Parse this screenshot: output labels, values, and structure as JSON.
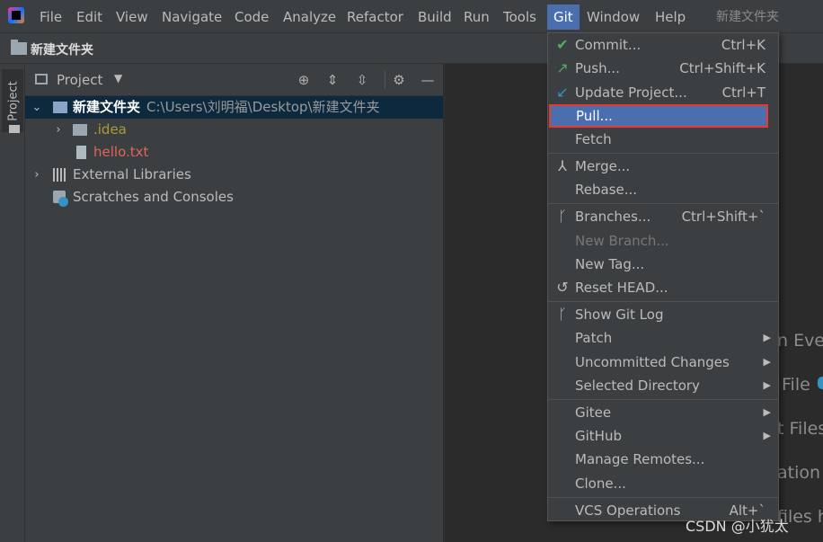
{
  "menubar": {
    "items": [
      "File",
      "Edit",
      "View",
      "Navigate",
      "Code",
      "Analyze",
      "Refactor",
      "Build",
      "Run",
      "Tools",
      "Git",
      "Window",
      "Help"
    ],
    "window_title": "新建文件夹"
  },
  "navbar": {
    "folder": "新建文件夹"
  },
  "stripe": {
    "project_tab": "Project"
  },
  "project_panel": {
    "title": "Project",
    "tree": [
      {
        "label": "新建文件夹",
        "path": "C:\\Users\\刘明福\\Desktop\\新建文件夹"
      },
      {
        "label": ".idea"
      },
      {
        "label": "hello.txt"
      },
      {
        "label": "External Libraries"
      },
      {
        "label": "Scratches and Consoles"
      }
    ]
  },
  "editor": {
    "hints": [
      "n Ever",
      "File",
      "t Files",
      "ation",
      "files h"
    ]
  },
  "git_menu": {
    "items": [
      {
        "label": "Commit...",
        "shortcut": "Ctrl+K"
      },
      {
        "label": "Push...",
        "shortcut": "Ctrl+Shift+K"
      },
      {
        "label": "Update Project...",
        "shortcut": "Ctrl+T"
      },
      {
        "label": "Pull..."
      },
      {
        "label": "Fetch"
      },
      {
        "label": "Merge..."
      },
      {
        "label": "Rebase..."
      },
      {
        "label": "Branches...",
        "shortcut": "Ctrl+Shift+`"
      },
      {
        "label": "New Branch..."
      },
      {
        "label": "New Tag..."
      },
      {
        "label": "Reset HEAD..."
      },
      {
        "label": "Show Git Log"
      },
      {
        "label": "Patch"
      },
      {
        "label": "Uncommitted Changes"
      },
      {
        "label": "Selected Directory"
      },
      {
        "label": "Gitee"
      },
      {
        "label": "GitHub"
      },
      {
        "label": "Manage Remotes..."
      },
      {
        "label": "Clone..."
      },
      {
        "label": "VCS Operations",
        "shortcut": "Alt+`"
      }
    ]
  },
  "watermark": "CSDN @小犹太"
}
